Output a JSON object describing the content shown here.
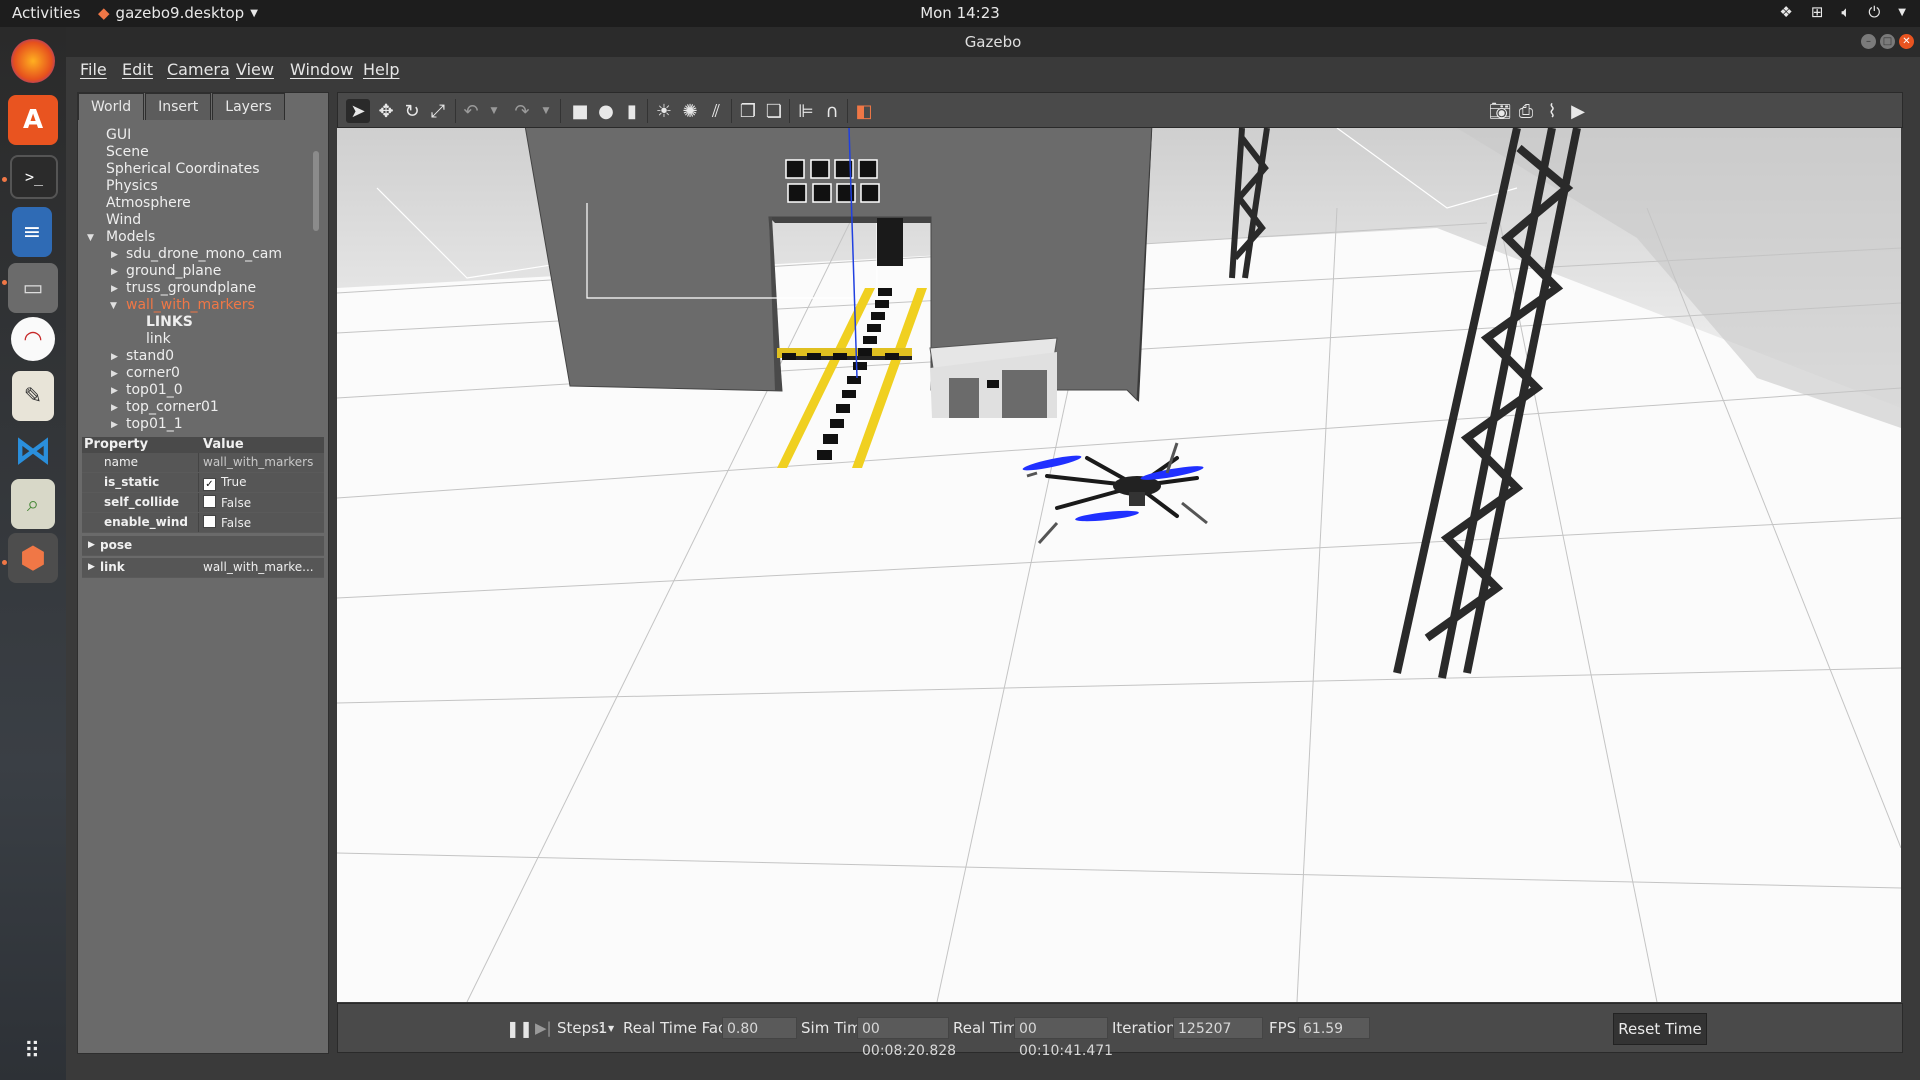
{
  "topbar": {
    "activities": "Activities",
    "app_menu": "gazebo9.desktop",
    "clock": "Mon 14:23"
  },
  "dock": {
    "icons": [
      "firefox-icon",
      "ubuntu-software-icon",
      "terminal-icon",
      "libreoffice-writer-icon",
      "files-icon",
      "document-viewer-icon",
      "text-editor-icon",
      "vscode-icon",
      "image-viewer-icon",
      "gazebo-icon",
      "show-applications-icon"
    ]
  },
  "window": {
    "title": "Gazebo"
  },
  "menu": {
    "file": "File",
    "edit": "Edit",
    "camera": "Camera",
    "view": "View",
    "window": "Window",
    "help": "Help"
  },
  "left_panel": {
    "tabs": [
      "World",
      "Insert",
      "Layers"
    ],
    "tree": {
      "gui": "GUI",
      "scene": "Scene",
      "spherical": "Spherical Coordinates",
      "physics": "Physics",
      "atmosphere": "Atmosphere",
      "wind": "Wind",
      "models": "Models",
      "model_items": [
        "sdu_drone_mono_cam",
        "ground_plane",
        "truss_groundplane",
        "wall_with_markers"
      ],
      "links_header": "LINKS",
      "link": "link",
      "more_items": [
        "stand0",
        "corner0",
        "top01_0",
        "top_corner01",
        "top01_1"
      ]
    },
    "properties": {
      "header_property": "Property",
      "header_value": "Value",
      "name_key": "name",
      "name_val": "wall_with_markers",
      "is_static_key": "is_static",
      "is_static_val": "True",
      "self_collide_key": "self_collide",
      "self_collide_val": "False",
      "enable_wind_key": "enable_wind",
      "enable_wind_val": "False",
      "pose_key": "pose",
      "link_key": "link",
      "link_val": "wall_with_marke..."
    }
  },
  "bottom": {
    "steps_label": "Steps:",
    "steps_value": "1",
    "rtf_label": "Real Time Factor:",
    "rtf_value": "0.80",
    "sim_label": "Sim Time:",
    "sim_value": "00 00:08:20.828",
    "real_label": "Real Time:",
    "real_value": "00 00:10:41.471",
    "iter_label": "Iterations:",
    "iter_value": "125207",
    "fps_label": "FPS:",
    "fps_value": "61.59",
    "reset": "Reset Time"
  },
  "colors": {
    "selected_model": "#f07746",
    "accent": "#e95420"
  }
}
